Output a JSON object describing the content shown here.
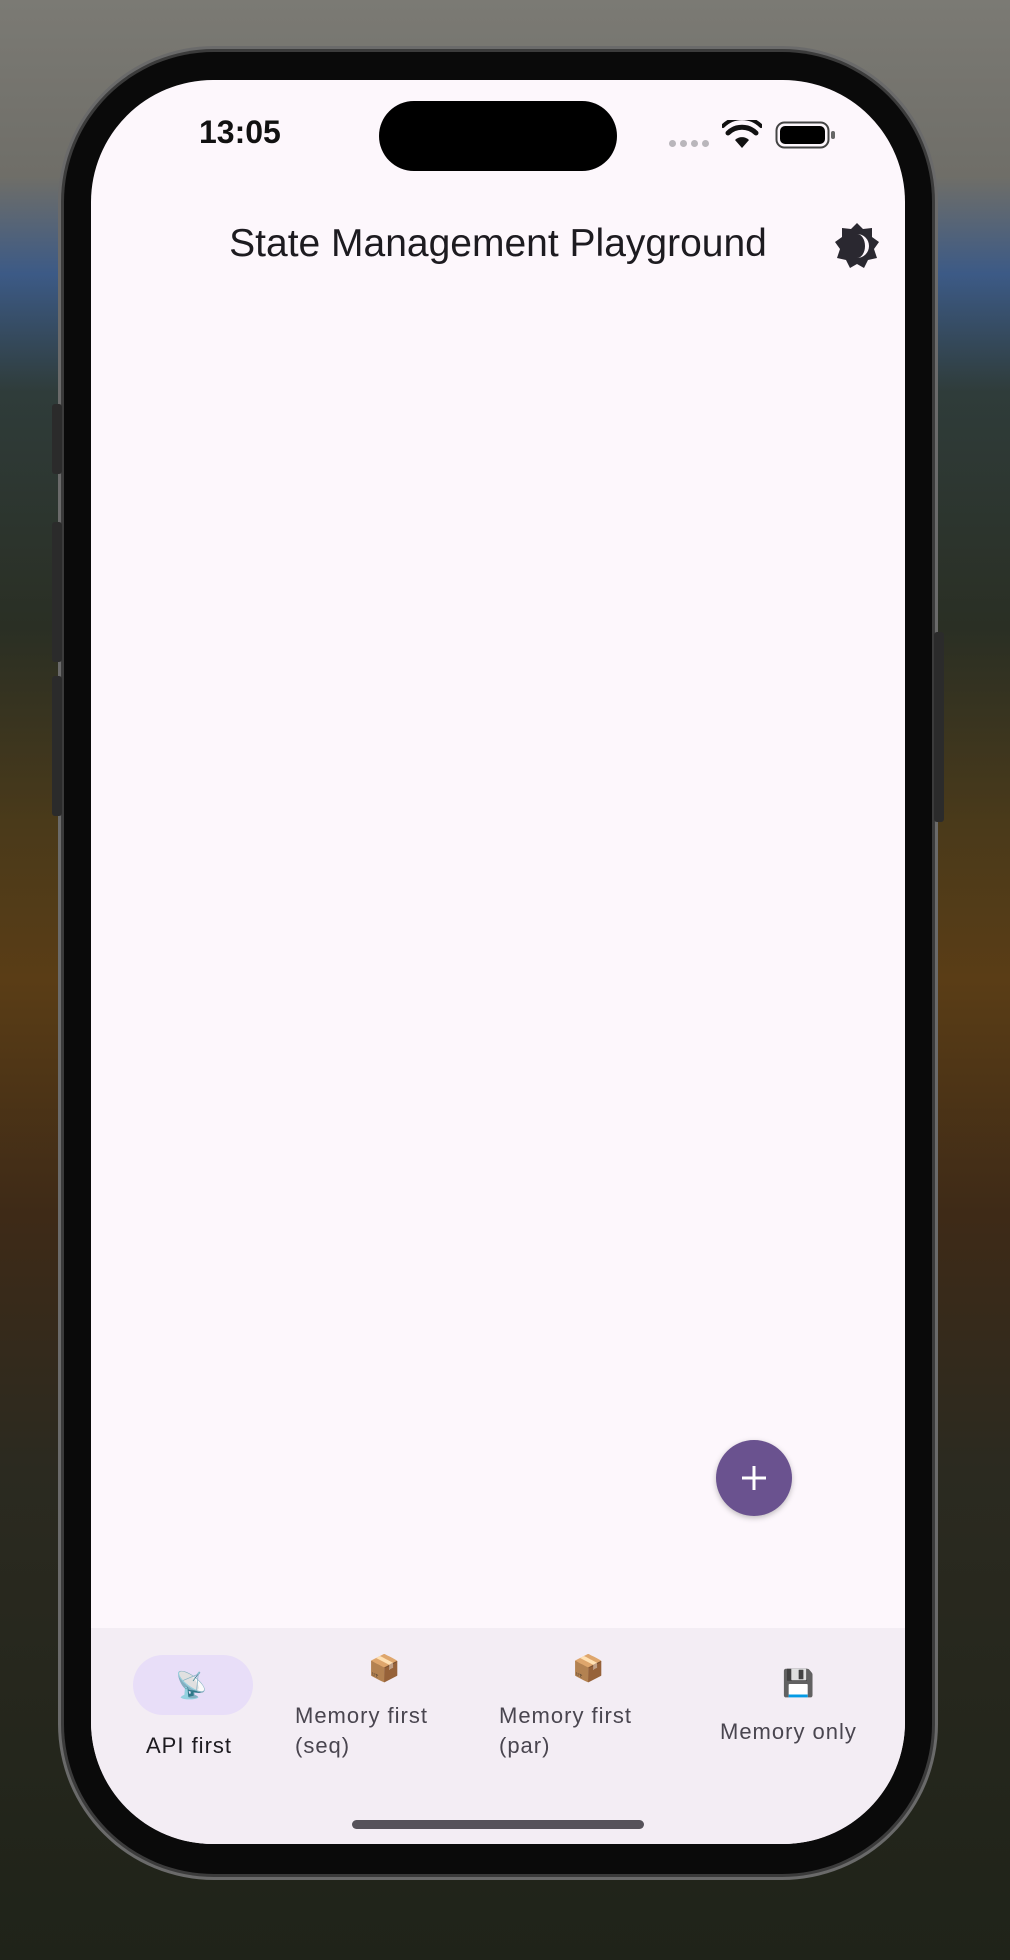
{
  "status_bar": {
    "time": "13:05",
    "wifi_icon": "wifi-icon",
    "battery_icon": "battery-icon"
  },
  "app_bar": {
    "title": "State Management Playground",
    "theme_icon": "brightness-icon"
  },
  "fab": {
    "icon": "plus-icon"
  },
  "nav": {
    "items": [
      {
        "label": "API first",
        "icon": "📡",
        "selected": true
      },
      {
        "label": "Memory first\n(seq)",
        "icon": "📦",
        "selected": false
      },
      {
        "label": "Memory first\n(par)",
        "icon": "📦",
        "selected": false
      },
      {
        "label": "Memory only",
        "icon": "💾",
        "selected": false
      }
    ]
  },
  "colors": {
    "surface": "#fdf7fc",
    "primary": "#6a528f",
    "nav_background": "#f3edf4",
    "nav_indicator": "#e8def8"
  }
}
